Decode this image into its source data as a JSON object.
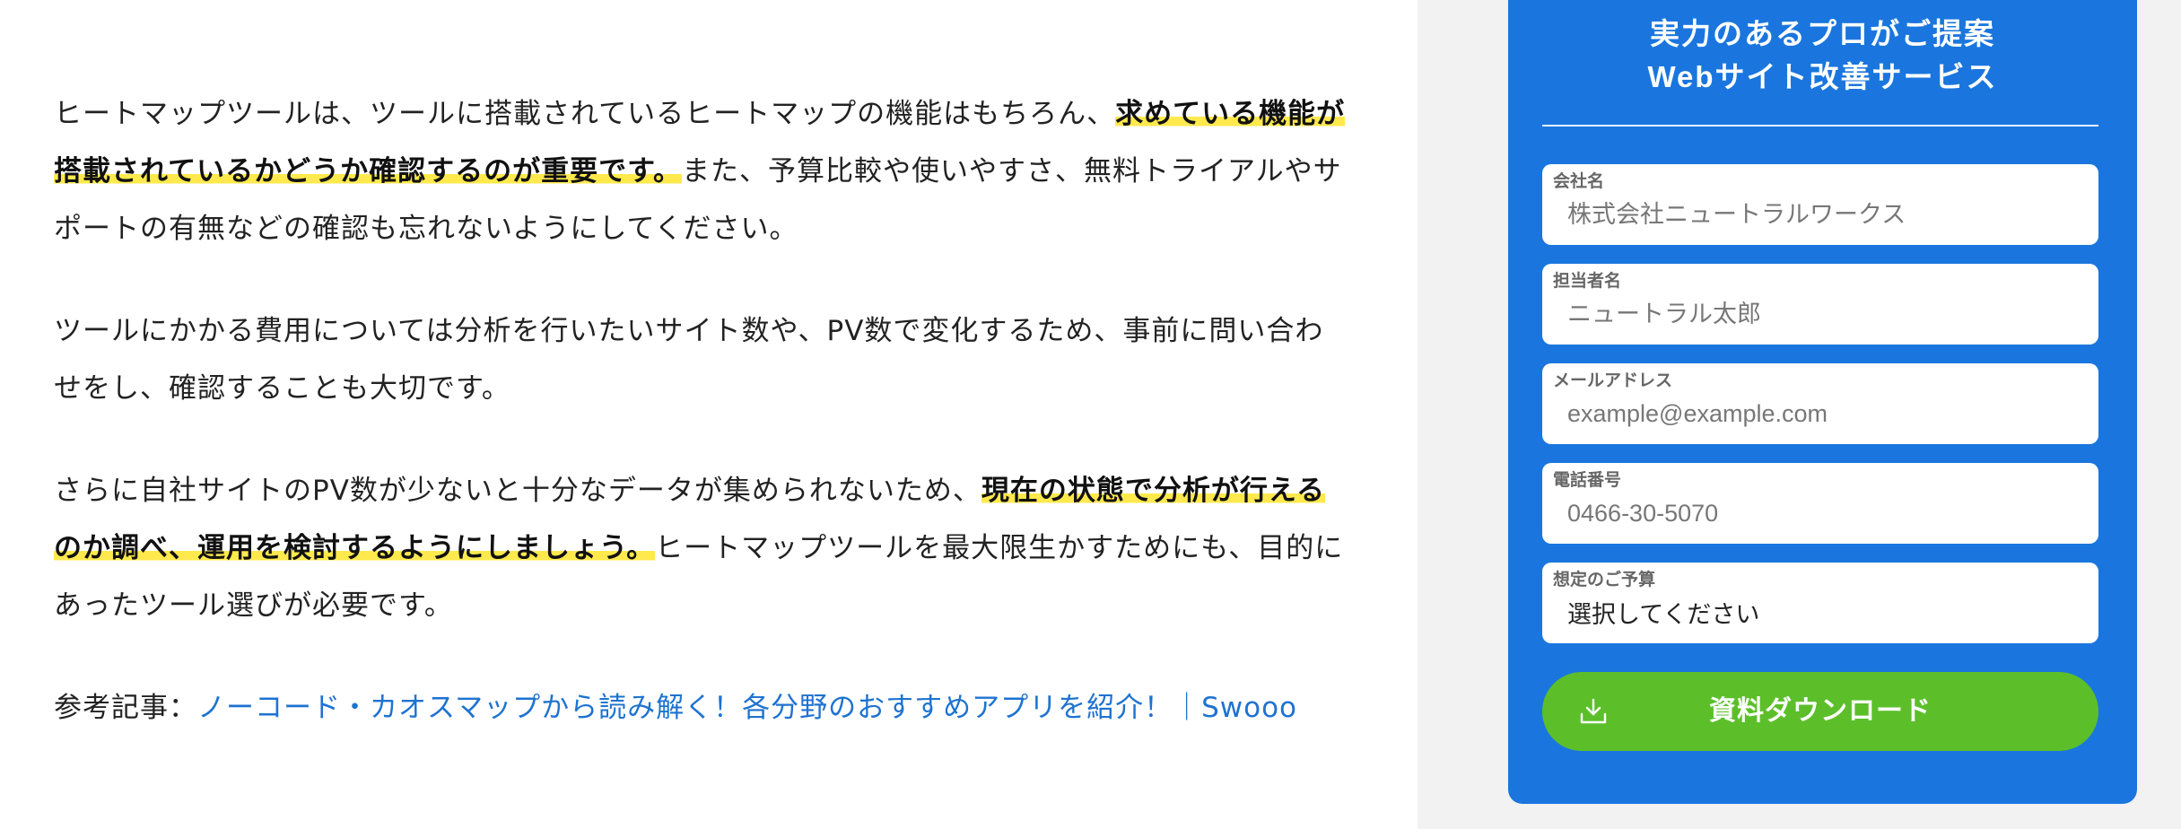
{
  "article": {
    "p1": {
      "t1": "ヒートマップツールは、ツールに搭載されているヒートマップの機能はもちろん、",
      "h1": "求めている機能が搭載されているかどうか確認するのが重要です。",
      "t2": "また、予算比較や使いやすさ、無料トライアルやサポートの有無などの確認も忘れないようにしてください。"
    },
    "p2": {
      "t1": "ツールにかかる費用については分析を行いたいサイト数や、PV数で変化するため、事前に問い合わせをし、確認することも大切です。"
    },
    "p3": {
      "t1": "さらに自社サイトのPV数が少ないと十分なデータが集められないため、",
      "h1": "現在の状態で分析が行えるのか調べ、運用を検討するようにしましょう。",
      "t2": "ヒートマップツールを最大限生かすためにも、目的にあったツール選びが必要です。"
    },
    "reference": {
      "prefix": "参考記事：",
      "link_text": "ノーコード・カオスマップから読み解く！各分野のおすすめアプリを紹介！｜Swooo"
    }
  },
  "sidebar": {
    "title_line1": "実力のあるプロがご提案",
    "title_line2": "Webサイト改善サービス",
    "fields": [
      {
        "label": "会社名",
        "placeholder": "株式会社ニュートラルワークス"
      },
      {
        "label": "担当者名",
        "placeholder": "ニュートラル太郎"
      },
      {
        "label": "メールアドレス",
        "placeholder": "example@example.com"
      },
      {
        "label": "電話番号",
        "placeholder": "0466-30-5070"
      },
      {
        "label": "想定のご予算",
        "value": "選択してください"
      }
    ],
    "download_button": {
      "label": "資料ダウンロード",
      "icon": "download-icon"
    }
  },
  "colors": {
    "panel": "#1a76de",
    "sidebar_bg": "#f2f2f2",
    "button": "#5cbf2a",
    "highlight": "#ffe94d",
    "link": "#1e73d0"
  }
}
